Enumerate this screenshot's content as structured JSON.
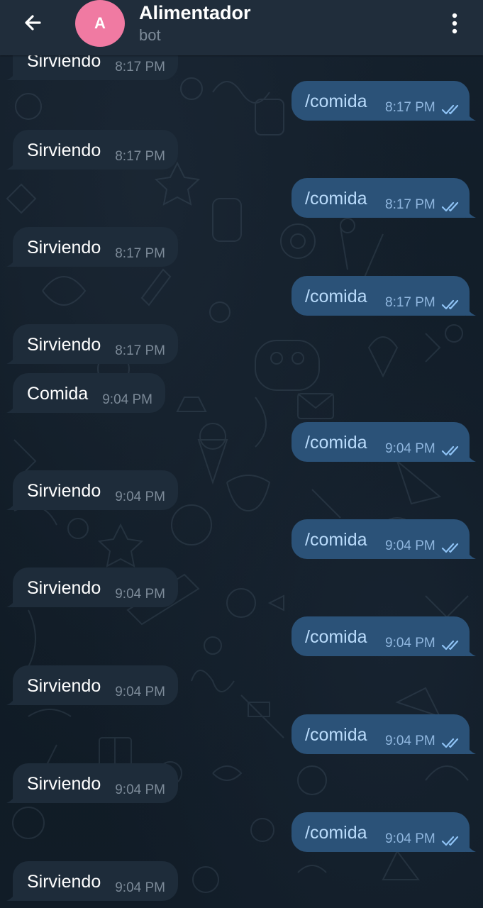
{
  "header": {
    "back_icon": "arrow-left-icon",
    "avatar_letter": "A",
    "avatar_color": "#f07aa2",
    "title": "Alimentador",
    "subtitle": "bot",
    "menu_icon": "more-vertical-icon"
  },
  "messages": [
    {
      "direction": "in",
      "text": "Sirviendo",
      "time": "8:17 PM"
    },
    {
      "direction": "out",
      "text": "/comida",
      "time": "8:17 PM",
      "status": "read"
    },
    {
      "direction": "in",
      "text": "Sirviendo",
      "time": "8:17 PM"
    },
    {
      "direction": "out",
      "text": "/comida",
      "time": "8:17 PM",
      "status": "read"
    },
    {
      "direction": "in",
      "text": "Sirviendo",
      "time": "8:17 PM"
    },
    {
      "direction": "out",
      "text": "/comida",
      "time": "8:17 PM",
      "status": "read"
    },
    {
      "direction": "in",
      "text": "Sirviendo",
      "time": "8:17 PM"
    },
    {
      "direction": "in",
      "text": "Comida",
      "time": "9:04 PM"
    },
    {
      "direction": "out",
      "text": "/comida",
      "time": "9:04 PM",
      "status": "read"
    },
    {
      "direction": "in",
      "text": "Sirviendo",
      "time": "9:04 PM"
    },
    {
      "direction": "out",
      "text": "/comida",
      "time": "9:04 PM",
      "status": "read"
    },
    {
      "direction": "in",
      "text": "Sirviendo",
      "time": "9:04 PM"
    },
    {
      "direction": "out",
      "text": "/comida",
      "time": "9:04 PM",
      "status": "read"
    },
    {
      "direction": "in",
      "text": "Sirviendo",
      "time": "9:04 PM"
    },
    {
      "direction": "out",
      "text": "/comida",
      "time": "9:04 PM",
      "status": "read"
    },
    {
      "direction": "in",
      "text": "Sirviendo",
      "time": "9:04 PM"
    },
    {
      "direction": "out",
      "text": "/comida",
      "time": "9:04 PM",
      "status": "read"
    },
    {
      "direction": "in",
      "text": "Sirviendo",
      "time": "9:04 PM"
    }
  ],
  "colors": {
    "header_bg": "#202d3b",
    "incoming_bubble": "#1e2c3a",
    "outgoing_bubble": "#2b5278",
    "outgoing_text": "#b9dbfb",
    "read_check": "#8fc3f5"
  }
}
